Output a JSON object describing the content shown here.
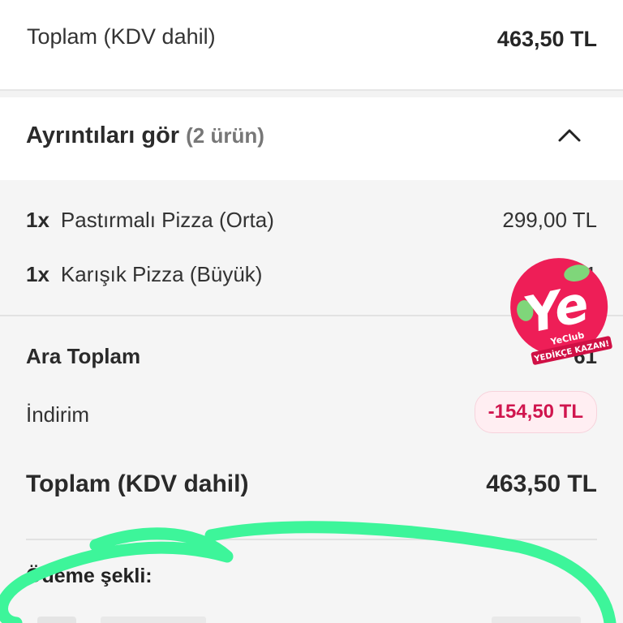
{
  "top_total": {
    "label": "Toplam (KDV dahil)",
    "value": "463,50 TL"
  },
  "details": {
    "title": "Ayrıntıları gör",
    "count": "(2 ürün)",
    "chevron": "chevron-up-icon"
  },
  "items": [
    {
      "qty": "1x",
      "name": "Pastırmalı Pizza (Orta)",
      "price": "299,00 TL"
    },
    {
      "qty": "1x",
      "name": "Karışık Pizza (Büyük)",
      "price": "31"
    }
  ],
  "subtotal": {
    "label": "Ara Toplam",
    "value": "61"
  },
  "discount": {
    "label": "İndirim",
    "value": "-154,50 TL"
  },
  "grand_total": {
    "label": "Toplam (KDV dahil)",
    "value": "463,50 TL"
  },
  "payment": {
    "label": "Ödeme şekli:"
  },
  "promo": {
    "logo_text": "Ye",
    "brand": "YeClub",
    "slogan": "YEDİKÇE KAZAN!",
    "color": "#ee1e57"
  },
  "colors": {
    "accent": "#d0154e",
    "marker": "#3df59a"
  }
}
